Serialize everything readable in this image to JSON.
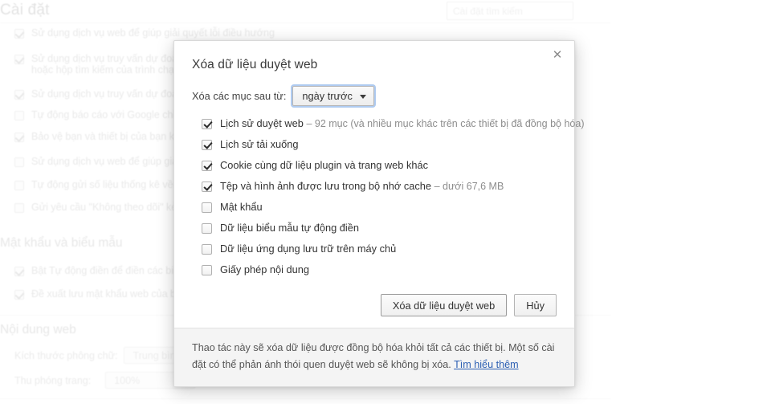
{
  "background": {
    "page_title": "Cài đặt",
    "search_placeholder": "Cài đặt tìm kiếm",
    "privacy_items": [
      {
        "label": "Sử dụng dịch vụ web để giúp giải quyết lỗi điều hướng",
        "checked": true
      },
      {
        "label": "Sử dụng dịch vụ truy vấn dự đoán",
        "label2": "hoặc hộp tìm kiếm của trình chạy",
        "checked": true
      },
      {
        "label": "Sử dụng dịch vụ truy vấn dự đoán",
        "checked": true
      },
      {
        "label": "Tự động báo cáo với Google chi t",
        "checked": false
      },
      {
        "label": "Bảo vệ bạn và thiết bị của bạn kh",
        "checked": true
      },
      {
        "label": "Sử dụng dịch vụ web để giúp giải",
        "checked": false
      },
      {
        "label": "Tự động gửi số liệu thống kê về v",
        "checked": false
      },
      {
        "label": "Gửi yêu cầu \"Không theo dõi\" kèm",
        "checked": false
      }
    ],
    "passwords_section": "Mật khẩu và biểu mẫu",
    "password_items": [
      {
        "label": "Bật Tự động điền để điền các biểu",
        "checked": true
      },
      {
        "label": "Đề xuất lưu mật khẩu web của bạ",
        "checked": true
      }
    ],
    "web_content_section": "Nội dung web",
    "font_size_label": "Kích thước phông chữ:",
    "font_size_value": "Trung bình",
    "page_zoom_label": "Thu phóng trang:",
    "page_zoom_value": "100%"
  },
  "dialog": {
    "title": "Xóa dữ liệu duyệt web",
    "close_icon": "close-icon",
    "period_label": "Xóa các mục sau từ:",
    "period_value": "ngày trước",
    "period_caret_icon": "chevron-down-icon",
    "options": [
      {
        "label": "Lịch sử duyệt web",
        "meta": "–  92 mục (và nhiều mục khác trên các thiết bị đã đồng bộ hóa)",
        "checked": true
      },
      {
        "label": "Lịch sử tải xuống",
        "meta": "",
        "checked": true
      },
      {
        "label": "Cookie cùng dữ liệu plugin và trang web khác",
        "meta": "",
        "checked": true
      },
      {
        "label": "Tệp và hình ảnh được lưu trong bộ nhớ cache",
        "meta": "–  dưới 67,6 MB",
        "checked": true
      },
      {
        "label": "Mật khẩu",
        "meta": "",
        "checked": false
      },
      {
        "label": "Dữ liệu biểu mẫu tự động điền",
        "meta": "",
        "checked": false
      },
      {
        "label": "Dữ liệu ứng dụng lưu trữ trên máy chủ",
        "meta": "",
        "checked": false
      },
      {
        "label": "Giấy phép nội dung",
        "meta": "",
        "checked": false
      }
    ],
    "confirm_label": "Xóa dữ liệu duyệt web",
    "cancel_label": "Hủy",
    "footer_text": "Thao tác này sẽ xóa dữ liệu được đồng bộ hóa khỏi tất cả các thiết bị. Một số cài đặt có thể phản ánh thói quen duyệt web sẽ không bị xóa.",
    "footer_link": "Tìm hiểu thêm"
  },
  "colors": {
    "link": "#2c5fb3",
    "focus_ring": "#6ea0e6",
    "footer_bg": "#f4f4f4"
  }
}
